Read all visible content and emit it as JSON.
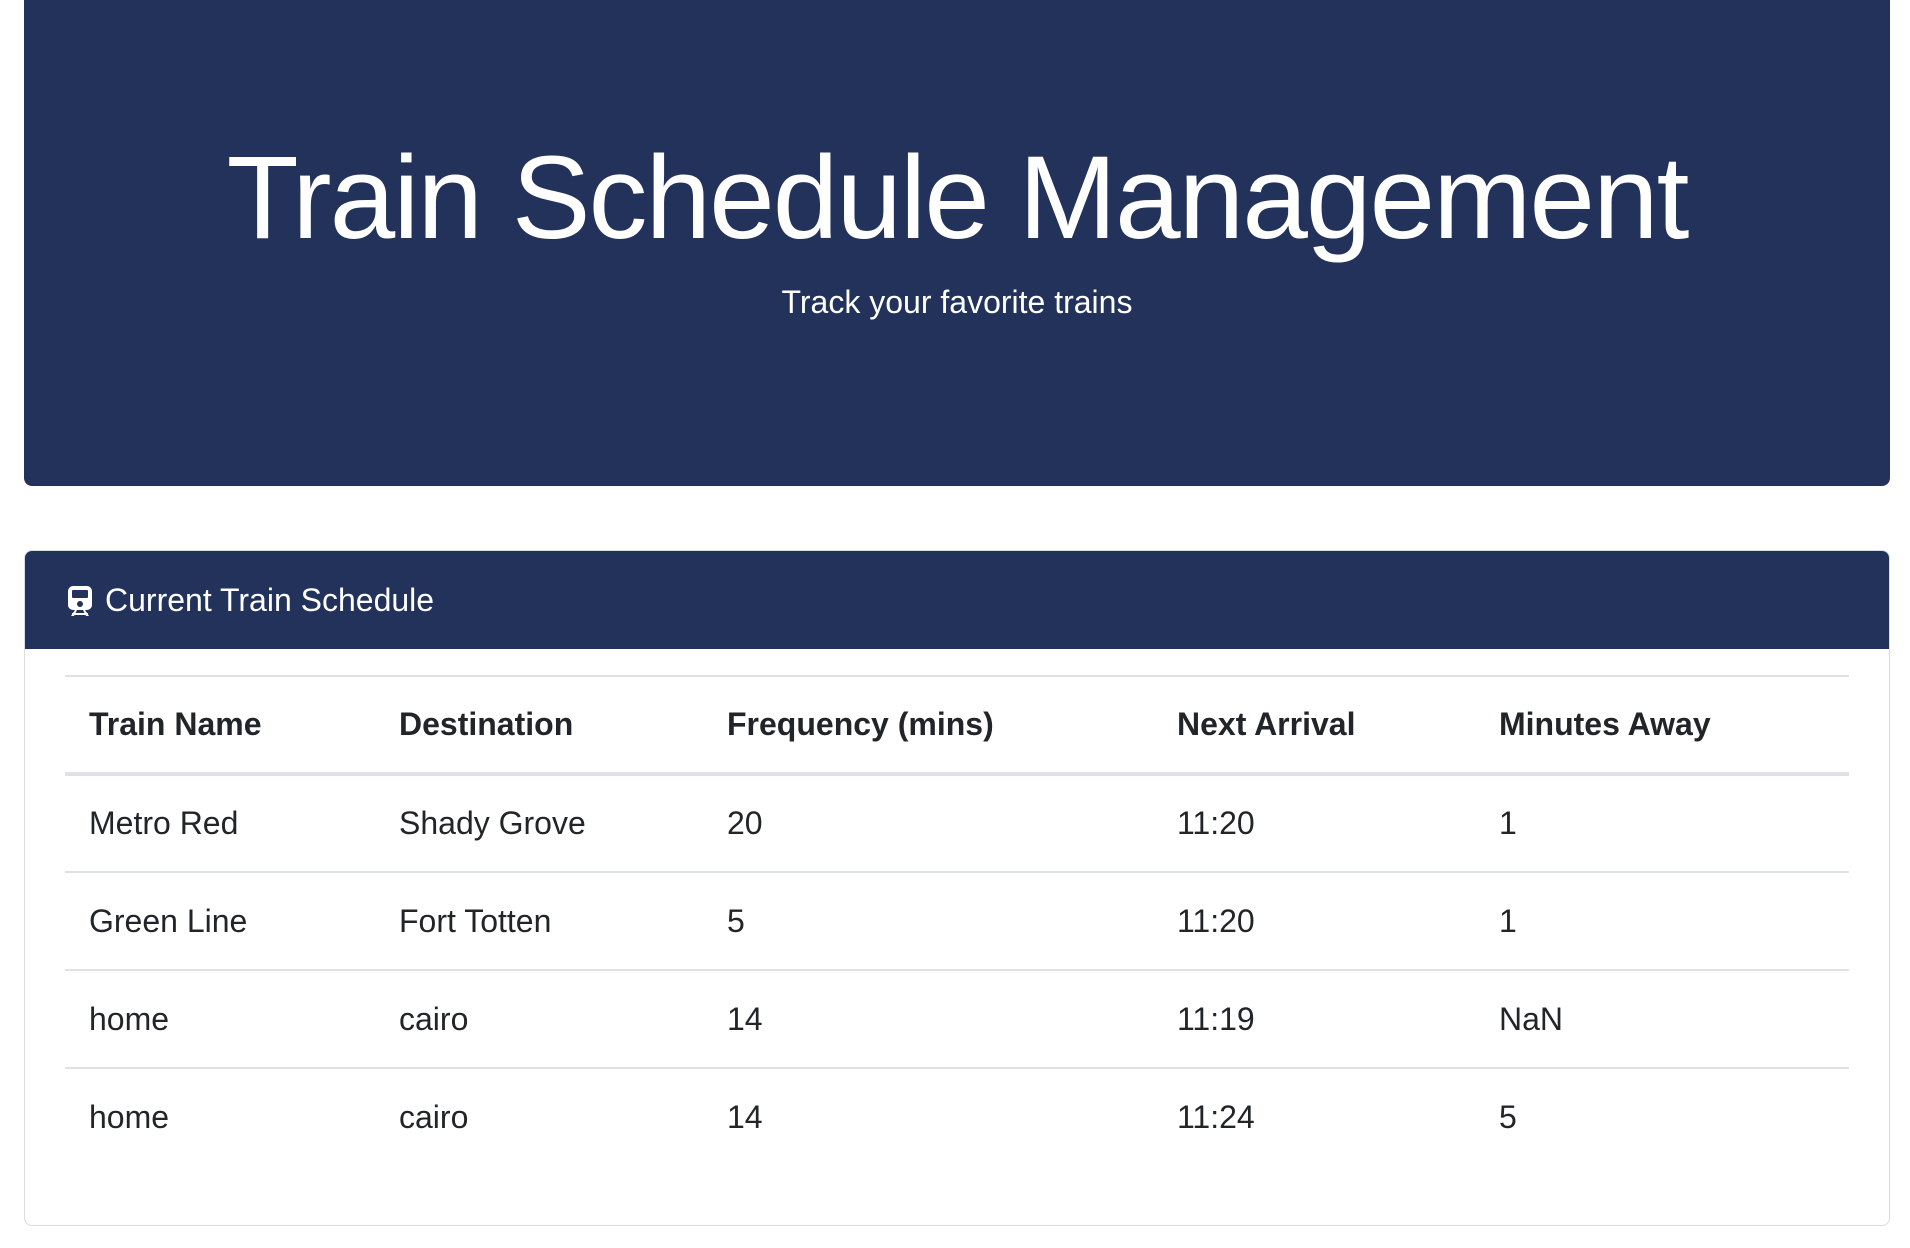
{
  "jumbotron": {
    "title": "Train Schedule Management",
    "subtitle": "Track your favorite trains"
  },
  "schedule_card": {
    "icon": "train-icon",
    "title": "Current Train Schedule",
    "columns": [
      "Train Name",
      "Destination",
      "Frequency (mins)",
      "Next Arrival",
      "Minutes Away"
    ],
    "rows": [
      [
        "Metro Red",
        "Shady Grove",
        "20",
        "11:20",
        "1"
      ],
      [
        "Green Line",
        "Fort Totten",
        "5",
        "11:20",
        "1"
      ],
      [
        "home",
        "cairo",
        "14",
        "11:19",
        "NaN"
      ],
      [
        "home",
        "cairo",
        "14",
        "11:24",
        "5"
      ]
    ]
  },
  "colors": {
    "header_bg": "#22325a",
    "header_text": "#ffffff",
    "table_border": "#dee2e6"
  }
}
